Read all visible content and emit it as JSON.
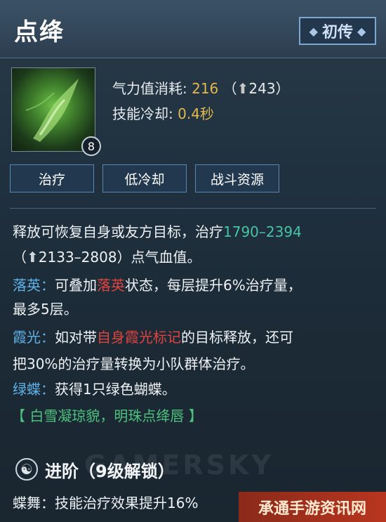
{
  "skill": {
    "name": "点绛",
    "rank_badge": "初传",
    "level": "8",
    "stats": {
      "cost_label": "气力值消耗:",
      "cost_value": "216",
      "cost_up": "（",
      "cost_up_value": "243",
      "cost_up_end": "）",
      "cooldown_label": "技能冷却:",
      "cooldown_value": "0.4秒"
    },
    "tags": [
      "治疗",
      "低冷却",
      "战斗资源"
    ]
  },
  "description": {
    "line1_a": "释放可恢复自身或友方目标，治疗",
    "line1_b": "1790–2394",
    "line2": "（",
    "line2_b": "2133–2808",
    "line2_c": "）点气血值。",
    "luoying_label": "落英：",
    "luoying_a": "可叠加",
    "luoying_b": "落英",
    "luoying_c": "状态，每层提升6%治疗量，",
    "luoying_d": "最多5层。",
    "xiaguang_label": "霞光：",
    "xiaguang_a": "如对带",
    "xiaguang_b": "自身霞光标记",
    "xiaguang_c": "的目标释放，还可",
    "xiaguang_d": "把30%的治疗量转换为小队群体治疗。",
    "lvdie_label": "绿蝶：",
    "lvdie_a": "获得1只绿色蝴蝶。",
    "source": "【 白雪凝琼貌，明珠点绛唇 】"
  },
  "advance": {
    "title": "进阶（9级解锁）",
    "line_label": "蝶舞：",
    "line_text": "技能治疗效果提升16%"
  },
  "watermark": {
    "bg_text": "GAMERSKY",
    "site": "承通手游资讯网"
  },
  "colors": {
    "heal_value": "#47c4a4",
    "highlight_red": "#e0433f",
    "label_blue": "#5fb1e8",
    "source_green": "#4cc27e",
    "cost_gold": "#e3b84f"
  },
  "icons": {
    "skill_icon": "green-flame-hand",
    "up_arrow": "up-arrow-icon",
    "advance_icon": "swirl-icon",
    "badge_ornament": "diamond-icon"
  }
}
